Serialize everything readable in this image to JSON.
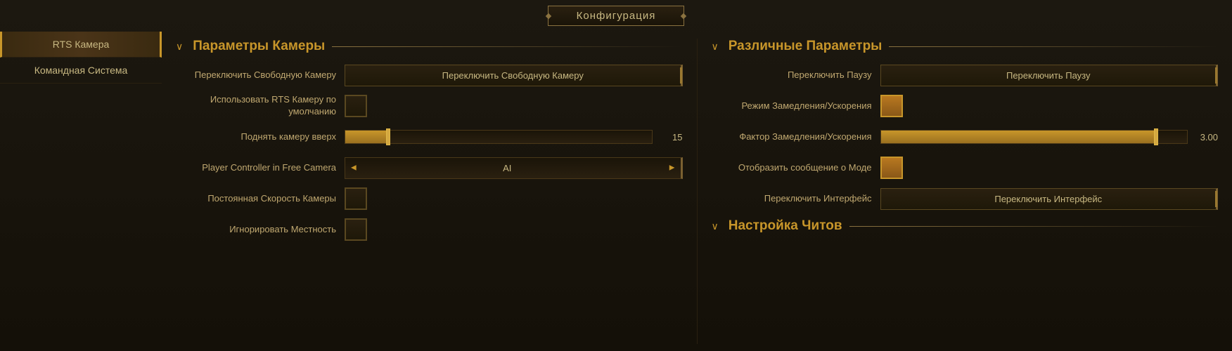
{
  "title": "Конфигурация",
  "sidebar": {
    "items": [
      {
        "id": "rts-camera",
        "label": "RTS Камера",
        "active": true
      },
      {
        "id": "command-system",
        "label": "Командная Система",
        "active": false
      }
    ]
  },
  "left_panel": {
    "section_title": "Параметры Камеры",
    "settings": [
      {
        "id": "toggle-free-camera",
        "label": "Переключить Свободную Камеру",
        "control_type": "button",
        "value": "Переключить Свободную Камеру"
      },
      {
        "id": "use-rts-default",
        "label": "Использовать RTS Камеру по умолчанию",
        "control_type": "checkbox",
        "checked": false
      },
      {
        "id": "raise-camera",
        "label": "Поднять камеру вверх",
        "control_type": "slider",
        "fill_percent": 14,
        "thumb_percent": 14,
        "value": "15"
      },
      {
        "id": "player-controller-free-camera",
        "label": "Player Controller in Free Camera",
        "control_type": "dropdown",
        "value": "AI"
      },
      {
        "id": "constant-camera-speed",
        "label": "Постоянная Скорость Камеры",
        "control_type": "checkbox",
        "checked": false
      },
      {
        "id": "ignore-terrain",
        "label": "Игнорировать Местность",
        "control_type": "checkbox",
        "checked": false
      }
    ]
  },
  "right_panel": {
    "section_title": "Различные Параметры",
    "settings": [
      {
        "id": "toggle-pause",
        "label": "Переключить Паузу",
        "control_type": "button",
        "value": "Переключить Паузу"
      },
      {
        "id": "slowdown-speedup-mode",
        "label": "Режим Замедления/Ускорения",
        "control_type": "checkbox",
        "checked": true
      },
      {
        "id": "slowdown-speedup-factor",
        "label": "Фактор Замедления/Ускорения",
        "control_type": "slider",
        "fill_percent": 90,
        "thumb_percent": 90,
        "value": "3.00"
      },
      {
        "id": "display-mode-message",
        "label": "Отобразить сообщение о Моде",
        "control_type": "checkbox",
        "checked": true
      },
      {
        "id": "toggle-interface",
        "label": "Переключить Интерфейс",
        "control_type": "button",
        "value": "Переключить Интерфейс"
      }
    ],
    "section2_title": "Настройка Читов"
  }
}
